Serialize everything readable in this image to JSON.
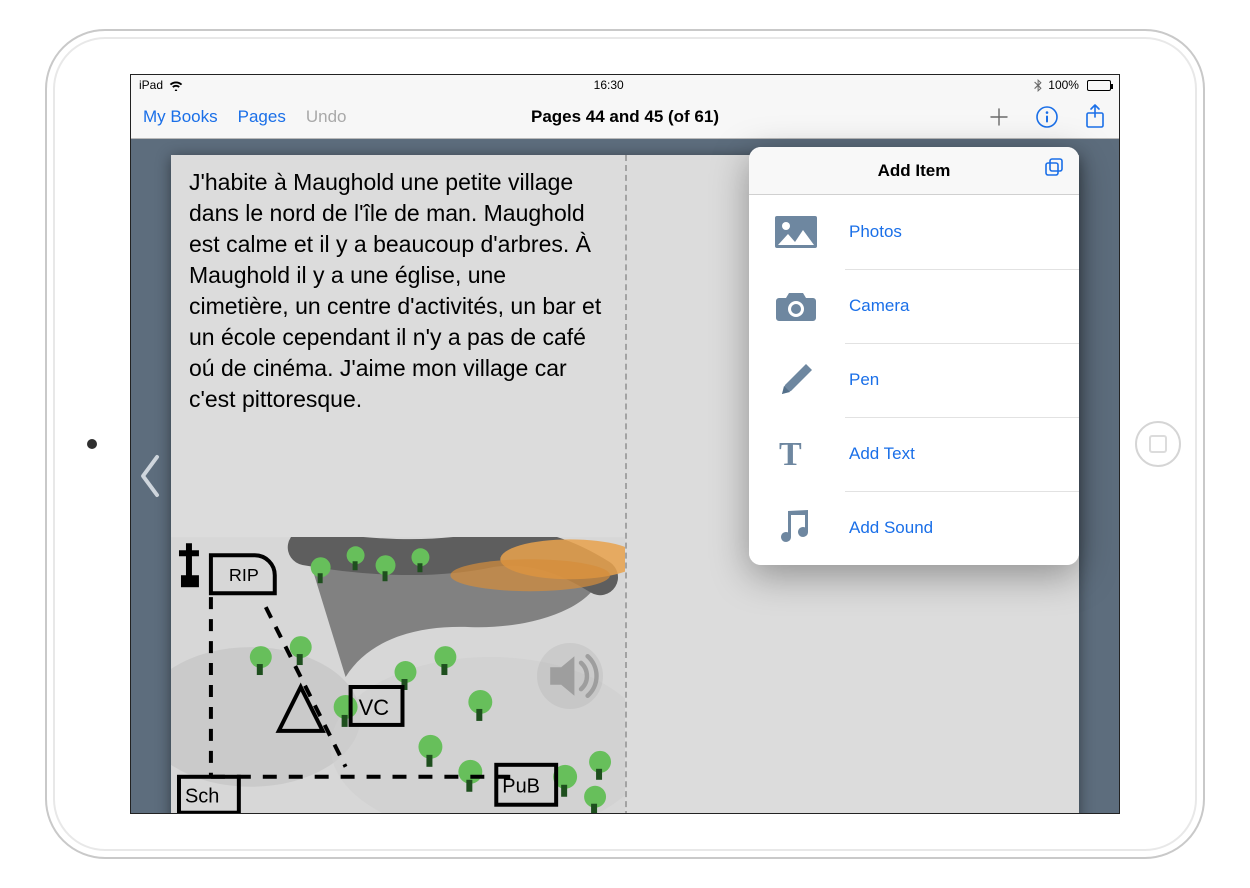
{
  "status": {
    "device": "iPad",
    "time": "16:30",
    "battery_pct": "100%"
  },
  "toolbar": {
    "my_books": "My Books",
    "pages": "Pages",
    "undo": "Undo",
    "title": "Pages 44 and 45 (of 61)"
  },
  "page": {
    "text": "J'habite à  Maughold une petite village dans le nord de l'île de man. Maughold est calme et il y a beaucoup d'arbres. À Maughold il y a une église, une cimetière, un centre d'activités, un bar et un école cependant il n'y a pas de café oú de cinéma. J'aime mon village car c'est pittoresque."
  },
  "drawing": {
    "labels": {
      "rip": "RIP",
      "sch": "Sch",
      "vc": "VC",
      "pub": "PuB"
    }
  },
  "popover": {
    "title": "Add Item",
    "items": [
      {
        "label": "Photos"
      },
      {
        "label": "Camera"
      },
      {
        "label": "Pen"
      },
      {
        "label": "Add Text"
      },
      {
        "label": "Add Sound"
      }
    ]
  }
}
